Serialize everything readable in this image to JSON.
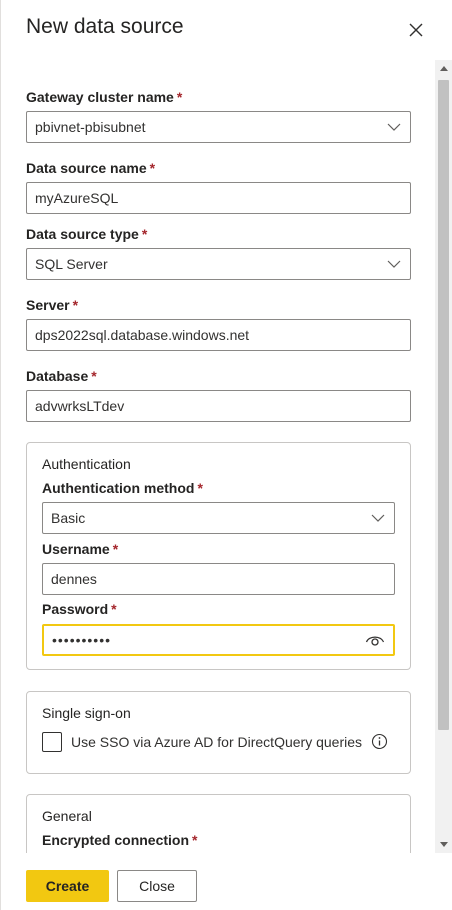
{
  "dialog": {
    "title": "New data source",
    "required_marker": "*"
  },
  "fields": {
    "gateway_cluster": {
      "label": "Gateway cluster name",
      "value": "pbivnet-pbisubnet"
    },
    "data_source_name": {
      "label": "Data source name",
      "value": "myAzureSQL"
    },
    "data_source_type": {
      "label": "Data source type",
      "value": "SQL Server"
    },
    "server": {
      "label": "Server",
      "value": "dps2022sql.database.windows.net"
    },
    "database": {
      "label": "Database",
      "value": "advwrksLTdev"
    }
  },
  "authentication": {
    "title": "Authentication",
    "method": {
      "label": "Authentication method",
      "value": "Basic"
    },
    "username": {
      "label": "Username",
      "value": "dennes"
    },
    "password": {
      "label": "Password",
      "value": "••••••••••"
    }
  },
  "single_sign_on": {
    "title": "Single sign-on",
    "checkbox_label": "Use SSO via Azure AD for DirectQuery queries",
    "checked": false
  },
  "general": {
    "title": "General",
    "encrypted_connection": {
      "label": "Encrypted connection"
    }
  },
  "footer": {
    "create_label": "Create",
    "close_label": "Close"
  },
  "colors": {
    "accent": "#f2c811",
    "required": "#a4262c",
    "border": "#8a8886"
  },
  "icons": {
    "close": "close-icon",
    "dropdown": "chevron-down-icon",
    "reveal_password": "eye-icon",
    "info": "info-icon"
  }
}
